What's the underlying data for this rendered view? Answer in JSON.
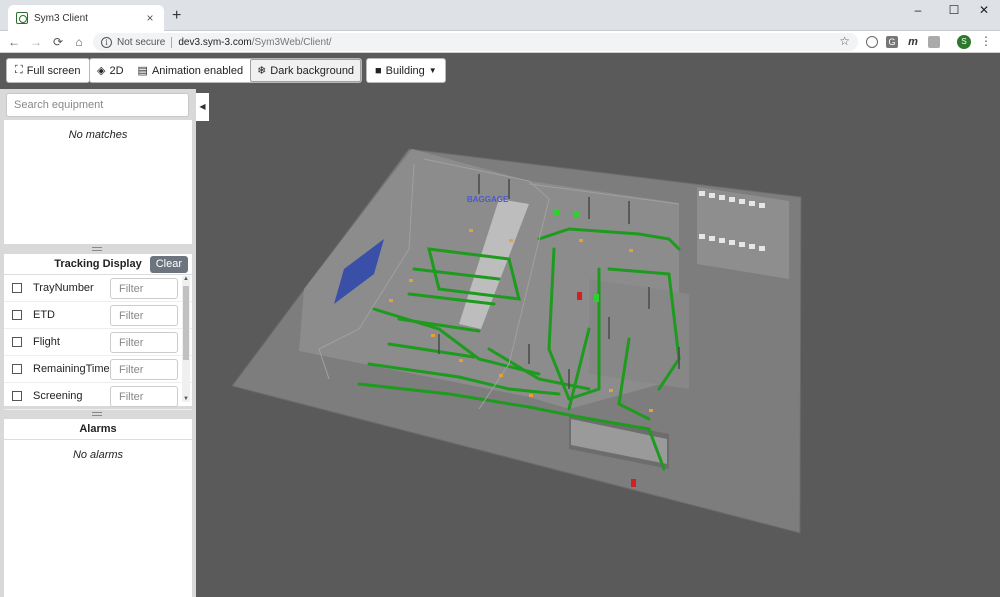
{
  "browser": {
    "tab_title": "Sym3 Client",
    "tab_close": "×",
    "new_tab": "+",
    "window_controls": {
      "minimize": "–",
      "maximize": "☐",
      "close": "✕"
    },
    "nav": {
      "back": "←",
      "forward": "→",
      "reload": "⟳",
      "home": "⌂"
    },
    "security_label": "Not secure",
    "url_host": "dev3.sym-3.com",
    "url_path": "/Sym3Web/Client/",
    "extensions": [
      "G",
      "m"
    ],
    "profile_initial": "S"
  },
  "toolbar": {
    "fullscreen_label": "Full screen",
    "view_2d_label": "2D",
    "animation_label": "Animation enabled",
    "dark_bg_label": "Dark background",
    "building_label": "Building"
  },
  "sidebar": {
    "search_placeholder": "Search equipment",
    "no_matches": "No matches",
    "tracking": {
      "title": "Tracking Display",
      "clear_label": "Clear",
      "filter_placeholder": "Filter",
      "fields": [
        "TrayNumber",
        "ETD",
        "Flight",
        "RemainingTime",
        "Screening"
      ]
    },
    "alarms": {
      "title": "Alarms",
      "empty": "No alarms"
    }
  },
  "scene": {
    "floor_color": "#7a7a7a",
    "background_color": "#5a5a5a",
    "conveyor_color": "#1e9a1e",
    "accent_color": "#e8a030",
    "alert_color": "#d02020",
    "building_sign": "BAGGAGE"
  }
}
